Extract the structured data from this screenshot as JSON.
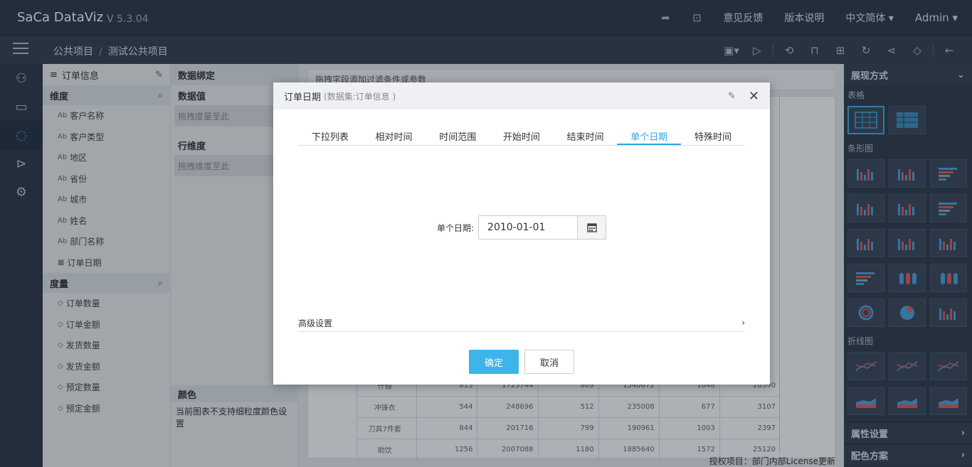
{
  "header": {
    "brand": "SaCa DataViz",
    "version": "V 5.3.04",
    "feedback": "意见反馈",
    "release_notes": "版本说明",
    "language": "中文简体",
    "user": "Admin"
  },
  "breadcrumb": {
    "project": "公共项目",
    "sep": "/",
    "current": "测试公共项目"
  },
  "dataset": {
    "title": "订单信息",
    "dimensions_label": "维度",
    "dimensions": [
      "客户名称",
      "客户类型",
      "地区",
      "省份",
      "城市",
      "姓名",
      "部门名称",
      "订单日期"
    ],
    "measures_label": "度量",
    "measures": [
      "订单数量",
      "订单金额",
      "发货数量",
      "发货金额",
      "预定数量",
      "预定金额"
    ]
  },
  "binding": {
    "title": "数据绑定",
    "values_label": "数据值",
    "values_placeholder": "拖拽度量至此",
    "rows_label": "行维度",
    "rows_placeholder": "拖拽维度至此",
    "color_label": "颜色",
    "color_note": "当前图表不支持细粒度颜色设置"
  },
  "canvas": {
    "filter_hint": "拖拽字段添加过滤条件或参数",
    "license": "授权项目：部门内部License更新",
    "rows": [
      [
        "什锦",
        "813",
        "1725744",
        "869",
        "1540672",
        "1048",
        "20590"
      ],
      [
        "冲锋衣",
        "544",
        "248696",
        "512",
        "235008",
        "677",
        "3107"
      ],
      [
        "刀具7件套",
        "844",
        "201716",
        "799",
        "190961",
        "1003",
        "2397"
      ],
      [
        "助饮",
        "1256",
        "2007088",
        "1180",
        "1885640",
        "1572",
        "25120"
      ]
    ]
  },
  "right_panel": {
    "title": "展现方式",
    "table_label": "表格",
    "bar_label": "条形图",
    "line_label": "折线图",
    "props_label": "属性设置",
    "palette_label": "配色方案"
  },
  "dialog": {
    "title": "订单日期",
    "dataset": "(数据集:订单信息 )",
    "tabs": [
      "下拉列表",
      "相对时间",
      "时间范围",
      "开始时间",
      "结束时间",
      "单个日期",
      "特殊时间"
    ],
    "active_tab": 5,
    "date_label": "单个日期:",
    "date_value": "2010-01-01",
    "advanced": "高级设置",
    "ok": "确定",
    "cancel": "取消"
  },
  "colors": {
    "accent": "#3db4ea",
    "topbar": "#2c3747"
  }
}
